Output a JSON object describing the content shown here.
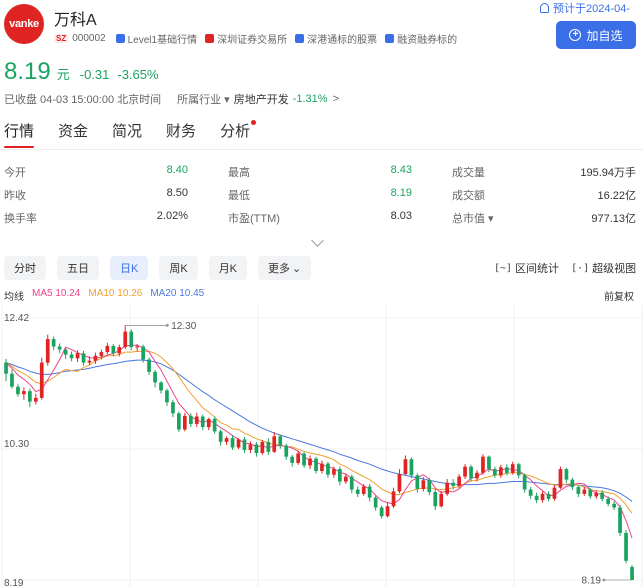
{
  "header": {
    "logo_text": "vanke",
    "stock_name": "万科A",
    "market": "SZ",
    "code": "000002",
    "tags": [
      {
        "label": "Level1基础行情",
        "color": "#3a6fe8"
      },
      {
        "label": "深圳证券交易所",
        "color": "#e02424"
      },
      {
        "label": "深港通标的股票",
        "color": "#3a6fe8"
      },
      {
        "label": "融资融券标的",
        "color": "#3a6fe8"
      }
    ],
    "forecast": "预计于2024-04-",
    "watch_button": "加自选"
  },
  "quote": {
    "price": "8.19",
    "unit": "元",
    "change": "-0.31",
    "change_pct": "-3.65%",
    "status": "已收盘 04-03 15:00:00 北京时间",
    "industry_label": "所属行业 ▾",
    "industry_name": "房地产开发",
    "industry_change": "-1.31%",
    "industry_arrow": ">"
  },
  "tabs": [
    "行情",
    "资金",
    "简况",
    "财务",
    "分析"
  ],
  "stats": [
    [
      {
        "label": "今开",
        "value": "8.40",
        "tone": "green"
      },
      {
        "label": "最高",
        "value": "8.43",
        "tone": "green"
      },
      {
        "label": "成交量",
        "value": "195.94万手",
        "tone": "plain"
      }
    ],
    [
      {
        "label": "昨收",
        "value": "8.50",
        "tone": "plain"
      },
      {
        "label": "最低",
        "value": "8.19",
        "tone": "green"
      },
      {
        "label": "成交额",
        "value": "16.22亿",
        "tone": "plain"
      }
    ],
    [
      {
        "label": "换手率",
        "value": "2.02%",
        "tone": "plain"
      },
      {
        "label": "市盈(TTM)",
        "value": "8.03",
        "tone": "plain"
      },
      {
        "label": "总市值 ▾",
        "value": "977.13亿",
        "tone": "plain"
      }
    ]
  ],
  "periods": [
    "分时",
    "五日",
    "日K",
    "周K",
    "月K",
    "更多"
  ],
  "active_period": "日K",
  "tools": {
    "range_stats": "区间统计",
    "super_view": "超级视图"
  },
  "ma": {
    "label": "均线",
    "items": [
      {
        "label": "MA5 10.24",
        "color": "#e8458b"
      },
      {
        "label": "MA10 10.26",
        "color": "#f0a030"
      },
      {
        "label": "MA20 10.45",
        "color": "#4a78e0"
      }
    ],
    "adjust": "前复权"
  },
  "chart_data": {
    "type": "candlestick",
    "y_max_label": "12.42",
    "y_mid_label": "10.30",
    "y_min_label": "8.19",
    "high_marker": "12.30",
    "low_marker": "8.19",
    "ylim": [
      8.19,
      12.42
    ],
    "up_color": "#e02424",
    "down_color": "#1aa35f",
    "candles": [
      [
        11.7,
        11.52,
        11.76,
        11.4
      ],
      [
        11.52,
        11.31,
        11.59,
        11.28
      ],
      [
        11.31,
        11.19,
        11.35,
        11.15
      ],
      [
        11.19,
        11.24,
        11.3,
        11.1
      ],
      [
        11.24,
        11.07,
        11.28,
        10.98
      ],
      [
        11.07,
        11.13,
        11.2,
        11.02
      ],
      [
        11.13,
        11.7,
        11.78,
        11.1
      ],
      [
        11.7,
        12.08,
        12.15,
        11.65
      ],
      [
        12.08,
        11.96,
        12.12,
        11.9
      ],
      [
        11.96,
        11.91,
        12.01,
        11.85
      ],
      [
        11.91,
        11.83,
        11.95,
        11.76
      ],
      [
        11.83,
        11.77,
        11.88,
        11.72
      ],
      [
        11.77,
        11.85,
        11.9,
        11.71
      ],
      [
        11.85,
        11.7,
        11.89,
        11.65
      ],
      [
        11.7,
        11.73,
        11.8,
        11.66
      ],
      [
        11.73,
        11.81,
        11.86,
        11.68
      ],
      [
        11.81,
        11.87,
        11.91,
        11.75
      ],
      [
        11.87,
        11.97,
        12.02,
        11.83
      ],
      [
        11.97,
        11.85,
        12.0,
        11.8
      ],
      [
        11.85,
        11.95,
        11.99,
        11.8
      ],
      [
        11.95,
        12.2,
        12.3,
        11.92
      ],
      [
        12.2,
        11.95,
        12.24,
        11.9
      ],
      [
        11.95,
        11.96,
        12.0,
        11.88
      ],
      [
        11.96,
        11.75,
        11.99,
        11.7
      ],
      [
        11.75,
        11.55,
        11.78,
        11.5
      ],
      [
        11.55,
        11.38,
        11.58,
        11.3
      ],
      [
        11.38,
        11.25,
        11.4,
        11.2
      ],
      [
        11.25,
        11.06,
        11.28,
        11.0
      ],
      [
        11.06,
        10.88,
        11.1,
        10.82
      ],
      [
        10.88,
        10.62,
        10.91,
        10.58
      ],
      [
        10.62,
        10.84,
        10.89,
        10.59
      ],
      [
        10.84,
        10.71,
        10.88,
        10.66
      ],
      [
        10.71,
        10.83,
        10.89,
        10.66
      ],
      [
        10.83,
        10.66,
        10.86,
        10.61
      ],
      [
        10.66,
        10.79,
        10.81,
        10.61
      ],
      [
        10.79,
        10.59,
        10.83,
        10.55
      ],
      [
        10.59,
        10.42,
        10.62,
        10.36
      ],
      [
        10.42,
        10.48,
        10.51,
        10.37
      ],
      [
        10.48,
        10.33,
        10.53,
        10.29
      ],
      [
        10.33,
        10.46,
        10.48,
        10.3
      ],
      [
        10.46,
        10.29,
        10.5,
        10.24
      ],
      [
        10.29,
        10.38,
        10.43,
        10.24
      ],
      [
        10.38,
        10.24,
        10.42,
        10.18
      ],
      [
        10.24,
        10.42,
        10.45,
        10.21
      ],
      [
        10.42,
        10.26,
        10.48,
        10.21
      ],
      [
        10.26,
        10.51,
        10.58,
        10.24
      ],
      [
        10.51,
        10.36,
        10.54,
        10.31
      ],
      [
        10.36,
        10.18,
        10.39,
        10.13
      ],
      [
        10.18,
        10.08,
        10.21,
        10.02
      ],
      [
        10.08,
        10.23,
        10.27,
        10.05
      ],
      [
        10.23,
        10.04,
        10.26,
        10.0
      ],
      [
        10.04,
        10.15,
        10.2,
        9.98
      ],
      [
        10.15,
        9.95,
        10.18,
        9.91
      ],
      [
        9.95,
        10.07,
        10.12,
        9.91
      ],
      [
        10.07,
        9.89,
        10.1,
        9.84
      ],
      [
        9.89,
        9.98,
        10.02,
        9.84
      ],
      [
        9.98,
        9.78,
        10.02,
        9.72
      ],
      [
        9.78,
        9.86,
        9.91,
        9.74
      ],
      [
        9.86,
        9.65,
        9.89,
        9.59
      ],
      [
        9.65,
        9.58,
        9.7,
        9.53
      ],
      [
        9.58,
        9.7,
        9.74,
        9.55
      ],
      [
        9.7,
        9.52,
        9.74,
        9.46
      ],
      [
        9.52,
        9.36,
        9.55,
        9.31
      ],
      [
        9.36,
        9.22,
        9.39,
        9.18
      ],
      [
        9.22,
        9.38,
        9.44,
        9.2
      ],
      [
        9.38,
        9.62,
        9.68,
        9.35
      ],
      [
        9.62,
        9.9,
        9.98,
        9.59
      ],
      [
        9.9,
        10.14,
        10.2,
        9.88
      ],
      [
        10.14,
        9.88,
        10.17,
        9.83
      ],
      [
        9.88,
        9.66,
        9.91,
        9.6
      ],
      [
        9.66,
        9.8,
        9.85,
        9.62
      ],
      [
        9.8,
        9.61,
        9.84,
        9.56
      ],
      [
        9.61,
        9.38,
        9.66,
        9.32
      ],
      [
        9.38,
        9.58,
        9.63,
        9.36
      ],
      [
        9.58,
        9.76,
        9.82,
        9.55
      ],
      [
        9.76,
        9.71,
        9.82,
        9.65
      ],
      [
        9.71,
        9.86,
        9.9,
        9.67
      ],
      [
        9.86,
        10.02,
        10.06,
        9.82
      ],
      [
        10.02,
        9.83,
        10.05,
        9.78
      ],
      [
        9.83,
        9.92,
        9.96,
        9.78
      ],
      [
        9.92,
        10.18,
        10.22,
        9.89
      ],
      [
        10.18,
        9.98,
        10.2,
        9.93
      ],
      [
        9.98,
        9.88,
        10.02,
        9.84
      ],
      [
        9.88,
        10.01,
        10.05,
        9.84
      ],
      [
        10.01,
        9.92,
        10.06,
        9.88
      ],
      [
        9.92,
        10.06,
        10.1,
        9.89
      ],
      [
        10.06,
        9.88,
        10.08,
        9.83
      ],
      [
        9.88,
        9.65,
        9.91,
        9.6
      ],
      [
        9.65,
        9.55,
        9.69,
        9.5
      ],
      [
        9.55,
        9.48,
        9.6,
        9.43
      ],
      [
        9.48,
        9.58,
        9.62,
        9.44
      ],
      [
        9.58,
        9.5,
        9.62,
        9.46
      ],
      [
        9.5,
        9.68,
        9.72,
        9.47
      ],
      [
        9.68,
        9.98,
        10.02,
        9.66
      ],
      [
        9.98,
        9.81,
        10.0,
        9.76
      ],
      [
        9.81,
        9.69,
        9.84,
        9.64
      ],
      [
        9.69,
        9.58,
        9.72,
        9.53
      ],
      [
        9.58,
        9.65,
        9.69,
        9.55
      ],
      [
        9.65,
        9.54,
        9.68,
        9.5
      ],
      [
        9.54,
        9.6,
        9.64,
        9.5
      ],
      [
        9.6,
        9.5,
        9.64,
        9.46
      ],
      [
        9.5,
        9.42,
        9.54,
        9.38
      ],
      [
        9.42,
        9.36,
        9.46,
        9.32
      ],
      [
        9.36,
        8.95,
        9.4,
        8.9
      ],
      [
        8.95,
        8.5,
        9.0,
        8.46
      ],
      [
        8.4,
        8.19,
        8.43,
        8.19
      ]
    ],
    "ma5": [
      11.7,
      11.61,
      11.5,
      11.43,
      11.35,
      11.23,
      11.27,
      11.42,
      11.58,
      11.75,
      11.95,
      11.91,
      11.86,
      11.82,
      11.78,
      11.77,
      11.79,
      11.82,
      11.85,
      11.89,
      11.97,
      11.98,
      11.98,
      11.94,
      11.87,
      11.72,
      11.58,
      11.4,
      11.22,
      11.04,
      10.93,
      10.82,
      10.78,
      10.73,
      10.77,
      10.72,
      10.65,
      10.59,
      10.52,
      10.46,
      10.4,
      10.39,
      10.34,
      10.36,
      10.32,
      10.36,
      10.36,
      10.35,
      10.32,
      10.27,
      10.18,
      10.12,
      10.09,
      10.05,
      10.02,
      9.99,
      9.93,
      9.9,
      9.83,
      9.77,
      9.71,
      9.66,
      9.56,
      9.47,
      9.44,
      9.42,
      9.49,
      9.65,
      9.79,
      9.84,
      9.89,
      9.82,
      9.67,
      9.6,
      9.63,
      9.61,
      9.66,
      9.75,
      9.83,
      9.86,
      9.92,
      9.98,
      9.95,
      9.96,
      9.99,
      9.97,
      9.96,
      9.88,
      9.81,
      9.71,
      9.63,
      9.55,
      9.56,
      9.64,
      9.7,
      9.73,
      9.75,
      9.74,
      9.65,
      9.59,
      9.57,
      9.52,
      9.48,
      9.37,
      9.15,
      8.87
    ],
    "ma10": [
      11.7,
      11.64,
      11.57,
      11.52,
      11.46,
      11.38,
      11.36,
      11.4,
      11.46,
      11.53,
      11.59,
      11.57,
      11.56,
      11.62,
      11.66,
      11.73,
      11.77,
      11.81,
      11.81,
      11.83,
      11.87,
      11.87,
      11.88,
      11.88,
      11.88,
      11.85,
      11.79,
      11.7,
      11.6,
      11.47,
      11.33,
      11.2,
      11.09,
      10.97,
      10.9,
      10.82,
      10.73,
      10.69,
      10.63,
      10.62,
      10.56,
      10.52,
      10.47,
      10.44,
      10.4,
      10.38,
      10.37,
      10.34,
      10.34,
      10.3,
      10.27,
      10.24,
      10.22,
      10.2,
      10.17,
      10.13,
      10.06,
      10.02,
      9.96,
      9.91,
      9.86,
      9.81,
      9.74,
      9.66,
      9.61,
      9.57,
      9.57,
      9.6,
      9.63,
      9.66,
      9.67,
      9.68,
      9.66,
      9.65,
      9.66,
      9.68,
      9.7,
      9.75,
      9.79,
      9.8,
      9.83,
      9.86,
      9.88,
      9.9,
      9.91,
      9.92,
      9.92,
      9.89,
      9.87,
      9.83,
      9.79,
      9.75,
      9.72,
      9.72,
      9.74,
      9.74,
      9.72,
      9.69,
      9.65,
      9.63,
      9.62,
      9.6,
      9.58,
      9.51,
      9.4,
      9.27
    ],
    "ma20": [
      11.7,
      11.67,
      11.63,
      11.6,
      11.56,
      11.53,
      11.51,
      11.51,
      11.52,
      11.54,
      11.56,
      11.57,
      11.58,
      11.59,
      11.61,
      11.63,
      11.65,
      11.67,
      11.68,
      11.7,
      11.72,
      11.73,
      11.74,
      11.74,
      11.73,
      11.71,
      11.68,
      11.63,
      11.58,
      11.51,
      11.44,
      11.37,
      11.3,
      11.23,
      11.17,
      11.1,
      11.04,
      10.98,
      10.92,
      10.86,
      10.8,
      10.74,
      10.69,
      10.64,
      10.6,
      10.56,
      10.53,
      10.5,
      10.47,
      10.44,
      10.41,
      10.38,
      10.35,
      10.32,
      10.29,
      10.26,
      10.22,
      10.19,
      10.16,
      10.12,
      10.09,
      10.06,
      10.02,
      9.98,
      9.95,
      9.92,
      9.9,
      9.88,
      9.86,
      9.84,
      9.82,
      9.8,
      9.78,
      9.76,
      9.75,
      9.74,
      9.73,
      9.73,
      9.73,
      9.73,
      9.74,
      9.75,
      9.75,
      9.76,
      9.77,
      9.78,
      9.78,
      9.78,
      9.77,
      9.76,
      9.75,
      9.74,
      9.73,
      9.73,
      9.73,
      9.73,
      9.72,
      9.71,
      9.7,
      9.69,
      9.68,
      9.66,
      9.63,
      9.59,
      9.53,
      9.46
    ]
  }
}
